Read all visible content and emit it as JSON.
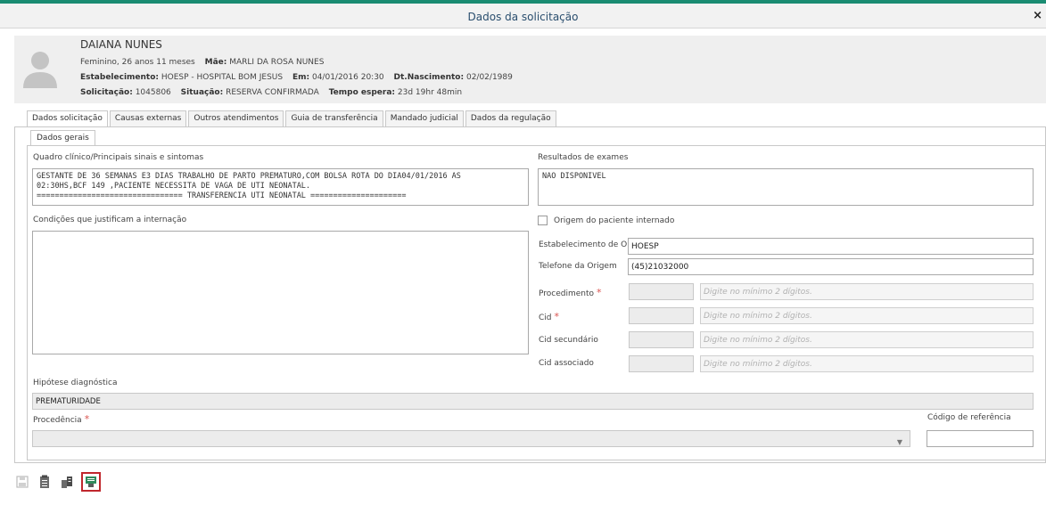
{
  "dialog": {
    "title": "Dados da solicitação",
    "close_label": "×"
  },
  "patient": {
    "name": "DAIANA NUNES",
    "sex_age": "Feminino, 26 anos 11 meses",
    "mother_label": "Mãe:",
    "mother": "MARLI DA ROSA NUNES",
    "estab_label": "Estabelecimento:",
    "estab": "HOESP - HOSPITAL BOM JESUS",
    "em_label": "Em:",
    "em": "04/01/2016 20:30",
    "birth_label": "Dt.Nascimento:",
    "birth": "02/02/1989",
    "solic_label": "Solicitação:",
    "solic": "1045806",
    "situ_label": "Situação:",
    "situ": "RESERVA CONFIRMADA",
    "wait_label": "Tempo espera:",
    "wait": "23d 19hr 48min"
  },
  "tabs": [
    "Dados solicitação",
    "Causas externas",
    "Outros atendimentos",
    "Guia de transferência",
    "Mandado judicial",
    "Dados da regulação"
  ],
  "subtab": "Dados gerais",
  "form": {
    "quadro_label": "Quadro clínico/Principais sinais e sintomas",
    "quadro_value": "GESTANTE DE 36 SEMANAS E3 DIAS TRABALHO DE PARTO PREMATURO,COM BOLSA ROTA DO DIA04/01/2016 AS\n02:30HS,BCF 149 ,PACIENTE NECESSITA DE VAGA DE UTI NEONATAL.\n================================ TRANSFERENCIA UTI NEONATAL =====================",
    "resultados_label": "Resultados de exames",
    "resultados_value": "NAO DISPONIVEL",
    "condicoes_label": "Condições que justificam a internação",
    "condicoes_value": "",
    "origem_checkbox_label": "Origem do paciente internado",
    "estab_origem_label": "Estabelecimento de Ori",
    "estab_origem_value": "HOESP",
    "telefone_label": "Telefone da Origem",
    "telefone_value": "(45)21032000",
    "procedimento_label": "Procedimento",
    "cid_label": "Cid",
    "cid_sec_label": "Cid secundário",
    "cid_assoc_label": "Cid associado",
    "placeholder": "Digite no mínimo 2 dígitos.",
    "required_mark": "*",
    "hipotese_label": "Hipótese diagnóstica",
    "hipotese_value": "PREMATURIDADE",
    "procedencia_label": "Procedência",
    "procedencia_value": "",
    "codigo_label": "Código de referência",
    "codigo_value": ""
  },
  "toolbar_icons": [
    "save-icon",
    "clipboard-icon",
    "copy-icon",
    "print-icon"
  ],
  "colors": {
    "accent": "#1a8c72",
    "title": "#2a4e6e",
    "required": "#d9534f",
    "highlight": "#c0272d"
  }
}
